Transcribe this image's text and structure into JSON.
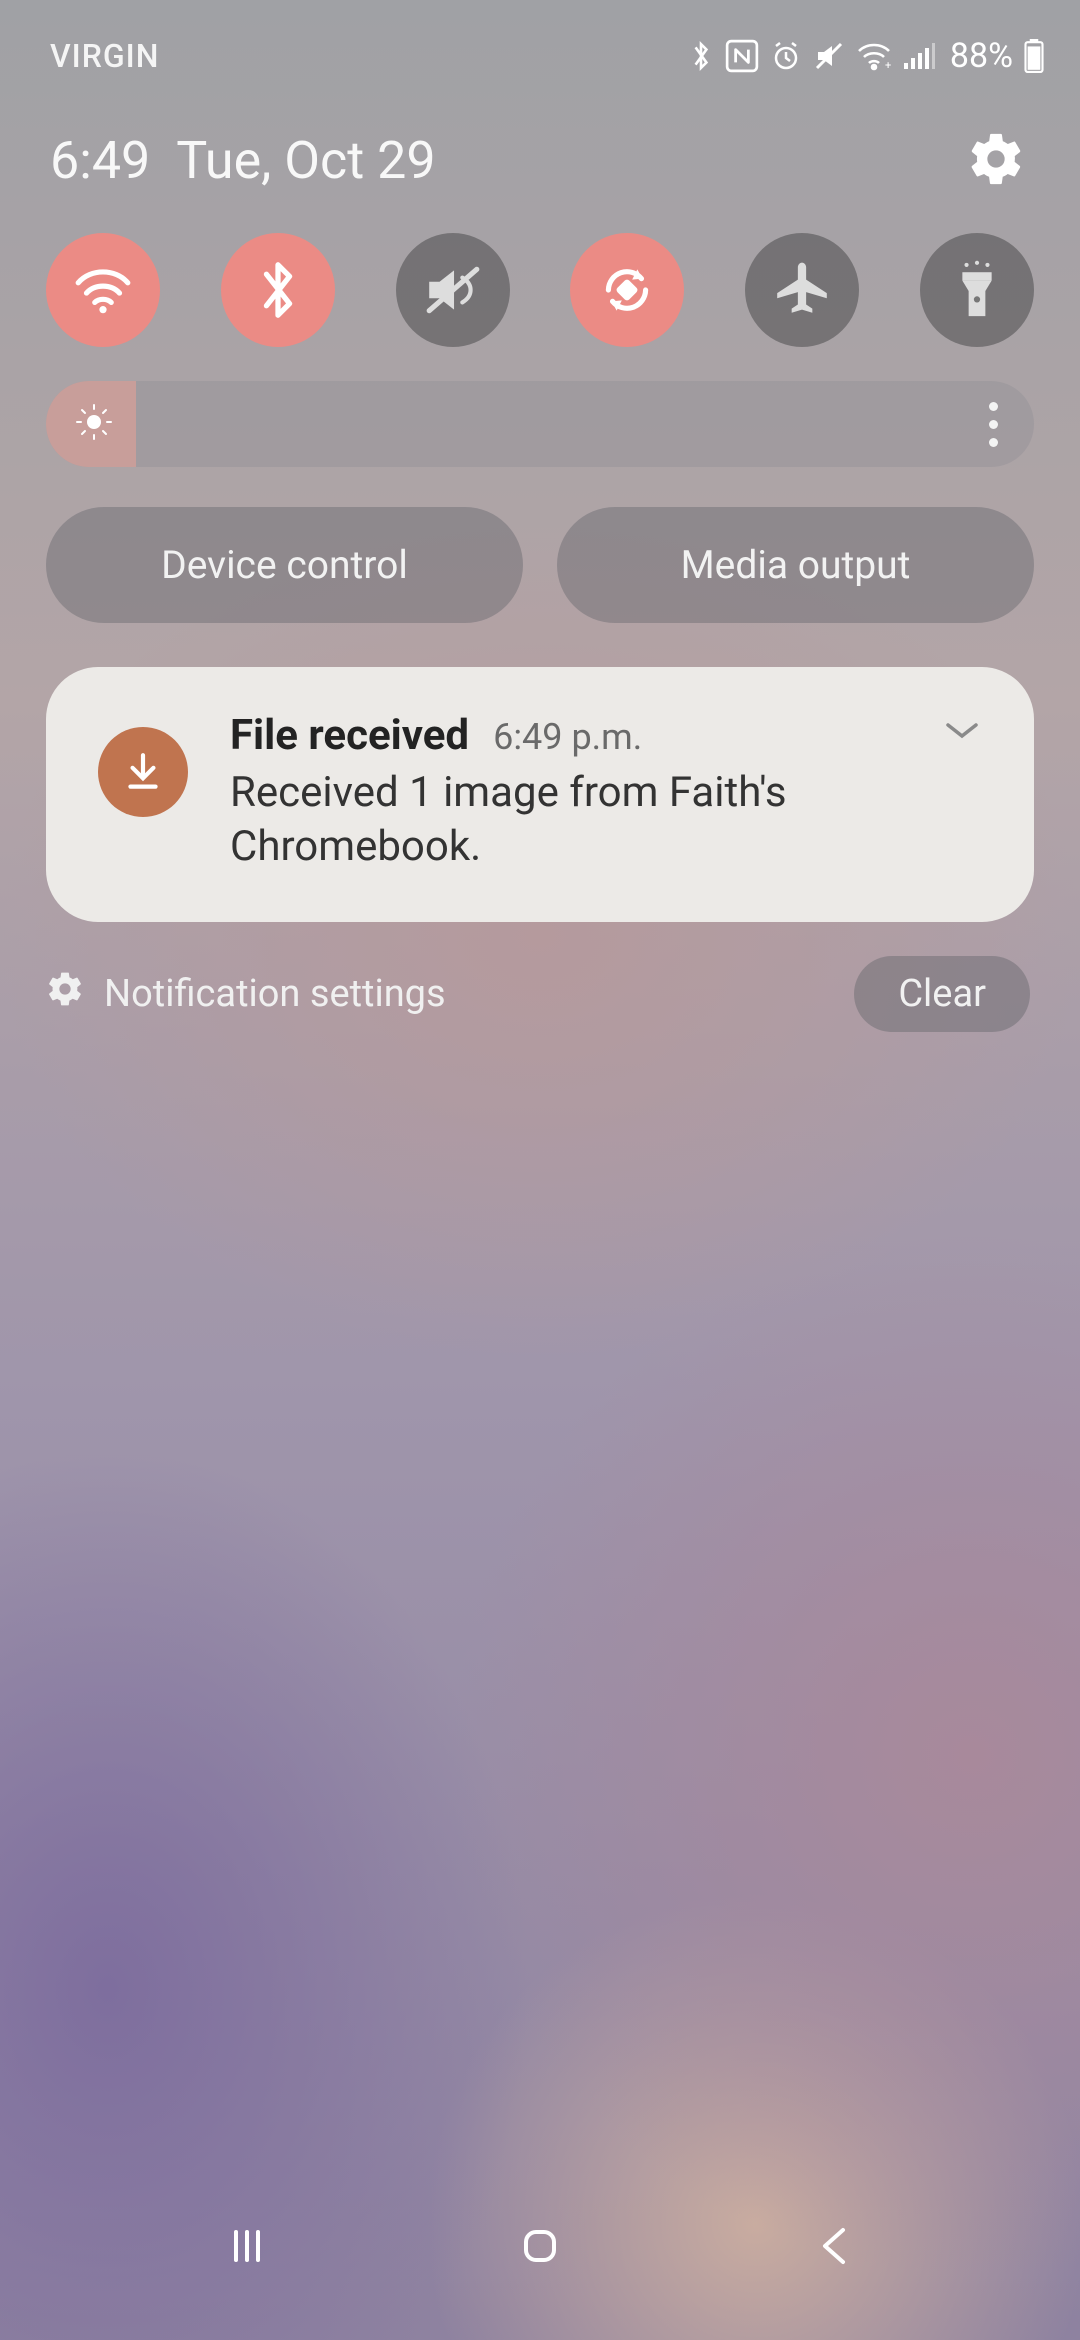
{
  "status": {
    "carrier": "VIRGIN",
    "battery": "88%"
  },
  "header": {
    "time": "6:49",
    "date": "Tue, Oct 29"
  },
  "qs": {
    "wifi": {
      "enabled": true,
      "name": "wifi"
    },
    "bluetooth": {
      "enabled": true,
      "name": "bluetooth"
    },
    "mute": {
      "enabled": false,
      "name": "mute"
    },
    "rotate": {
      "enabled": true,
      "name": "auto-rotate"
    },
    "airplane": {
      "enabled": false,
      "name": "airplane-mode"
    },
    "flashlight": {
      "enabled": false,
      "name": "flashlight"
    }
  },
  "controls": {
    "device_control": "Device control",
    "media_output": "Media output"
  },
  "notification": {
    "title": "File received",
    "time": "6:49 p.m.",
    "body": "Received 1 image from Faith's Chromebook."
  },
  "footer": {
    "settings_label": "Notification settings",
    "clear_label": "Clear"
  },
  "colors": {
    "accent_on": "#eb8b85",
    "notif_icon": "#c0744f"
  }
}
